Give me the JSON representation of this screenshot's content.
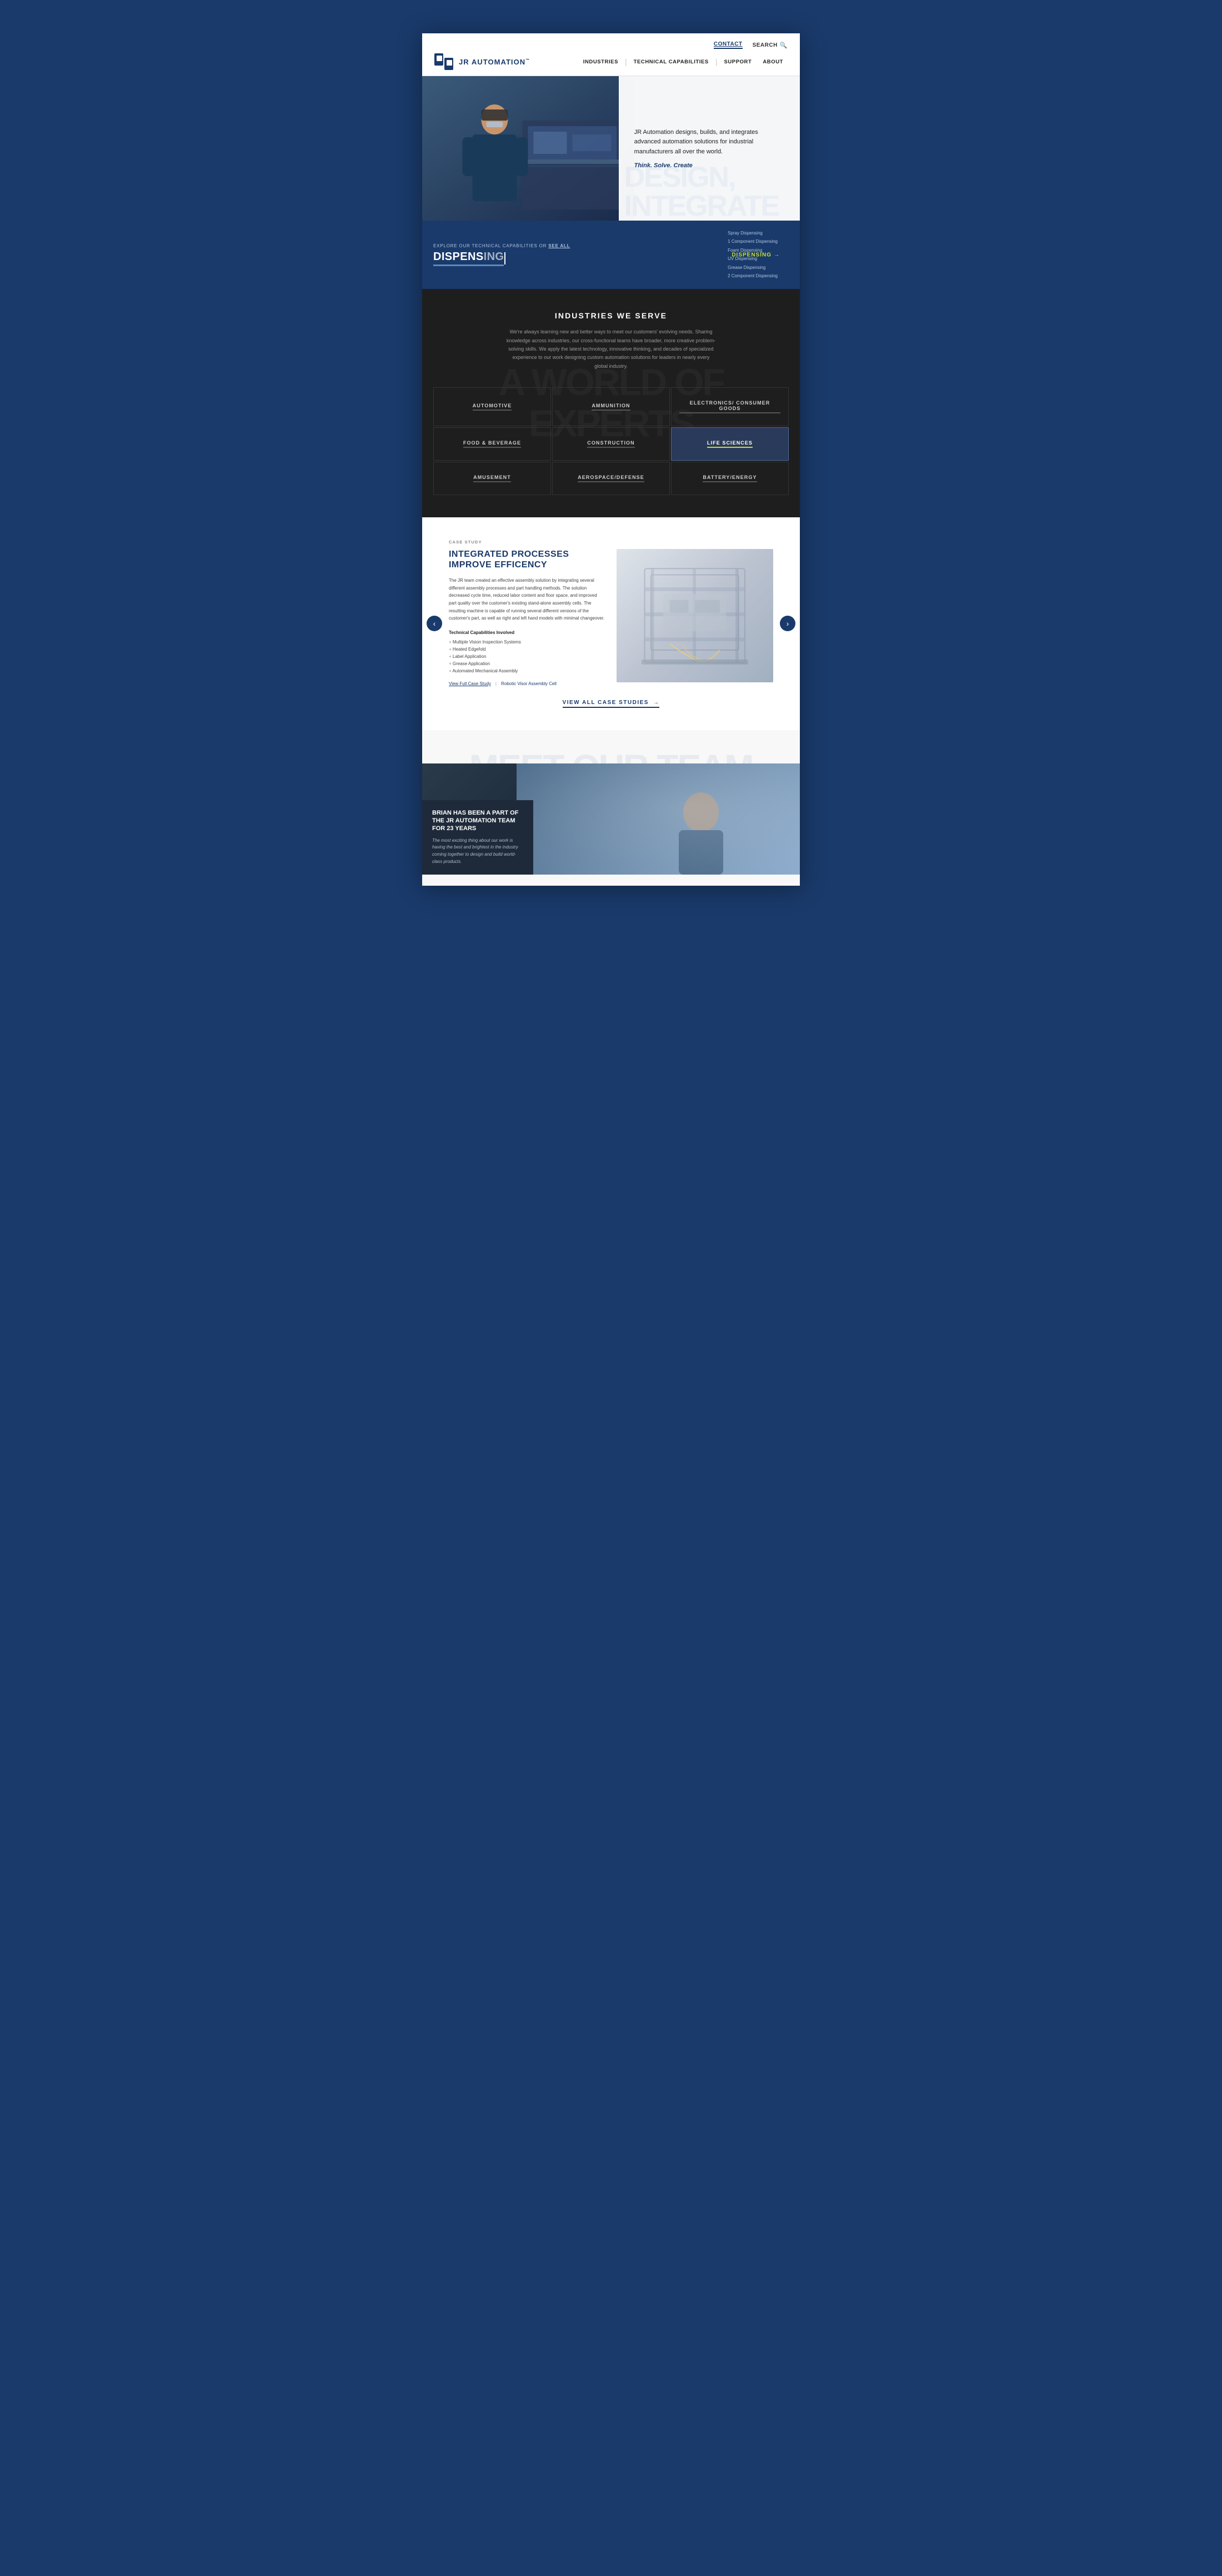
{
  "site": {
    "background_color": "#1a3a6b"
  },
  "header": {
    "logo_text": "JR AUTOMATION",
    "logo_tm": "™",
    "contact_label": "CONTACT",
    "search_label": "SEARCH",
    "nav_items": [
      {
        "id": "industries",
        "label": "INDUSTRIES"
      },
      {
        "id": "technical-capabilities",
        "label": "TECHNICAL CAPABILITIES"
      },
      {
        "id": "support",
        "label": "SUPPORT"
      },
      {
        "id": "about",
        "label": "ABOUT"
      }
    ]
  },
  "hero": {
    "description": "JR Automation designs, builds, and integrates advanced automation solutions for industrial manufacturers all over the world.",
    "tagline": "Think. Solve. Create",
    "bg_text_line1": "DESIGN,",
    "bg_text_line2": "INTEGRATE"
  },
  "dispensing": {
    "explore_label": "EXPLORE OUR TECHNICAL CAPABILITIES OR",
    "see_all_label": "SEE ALL",
    "title": "DISPENS",
    "title_typing": "ING",
    "list_items": [
      "Spray Dispensing",
      "1 Component Dispensing",
      "Foam Dispensing",
      "UV Dispensing",
      "Grease Dispensing",
      "2 Component Dispensing"
    ],
    "cta_label": "DISPENSING",
    "cta_arrow": "→"
  },
  "industries": {
    "bg_text_line1": "A WORLD OF",
    "bg_text_line2": "EXPERTS",
    "title": "INDUSTRIES WE SERVE",
    "subtitle": "We're always learning new and better ways to meet our customers' evolving needs. Sharing knowledge across industries, our cross-functional teams have broader, more creative problem-solving skills. We apply the latest technology, innovative thinking, and decades of specialized experience to our work designing custom automation solutions for leaders in nearly every global industry.",
    "items": [
      {
        "id": "automotive",
        "label": "AUTOMOTIVE",
        "active": false
      },
      {
        "id": "ammunition",
        "label": "AMMUNITION",
        "active": false
      },
      {
        "id": "electronics",
        "label": "ELECTRONICS/ CONSUMER GOODS",
        "active": false
      },
      {
        "id": "food-beverage",
        "label": "FOOD & BEVERAGE",
        "active": false
      },
      {
        "id": "construction",
        "label": "CONSTRUCTION",
        "active": false
      },
      {
        "id": "life-sciences",
        "label": "LIFE SCIENCES",
        "active": true
      },
      {
        "id": "amusement",
        "label": "AMUSEMENT",
        "active": false
      },
      {
        "id": "aerospace",
        "label": "AEROSPACE/DEFENSE",
        "active": false
      },
      {
        "id": "battery-energy",
        "label": "BATTERY/ENERGY",
        "active": false
      }
    ]
  },
  "case_study": {
    "label": "CASE STUDY",
    "title_line1": "INTEGRATED PROCESSES",
    "title_line2": "IMPROVE EFFICENCY",
    "description": "The JR team created an effective assembly solution by integrating several different assembly processes and part handling methods. The solution decreased cycle time, reduced labor content and floor space, and improved part quality over the customer's existing stand-alone assembly cells. The resulting machine is capable of running several different versions of the customer's part, as well as right and left hand models with minimal changeover.",
    "tech_cap_label": "Technical Capabilities Involved",
    "tech_cap_items": [
      "Multiple Vision Inspection Systems",
      "Heated Edgefold",
      "Label Application",
      "Grease Application",
      "Automated Mechanical Assembly"
    ],
    "view_full_label": "View Full Case Study",
    "separator": "|",
    "project_name": "Robotic Visor Assembly Cell",
    "view_all_label": "VIEW ALL CASE STUDIES",
    "view_all_arrow": "→"
  },
  "meet_team": {
    "bg_text": "MEET OUR TEAM",
    "card_name": "BRIAN HAS BEEN A PART OF THE JR AUTOMATION TEAM FOR 23 YEARS",
    "card_quote": "The most exciting thing about our work is having the best and brightest in the industry coming together to design and build world-class products."
  }
}
